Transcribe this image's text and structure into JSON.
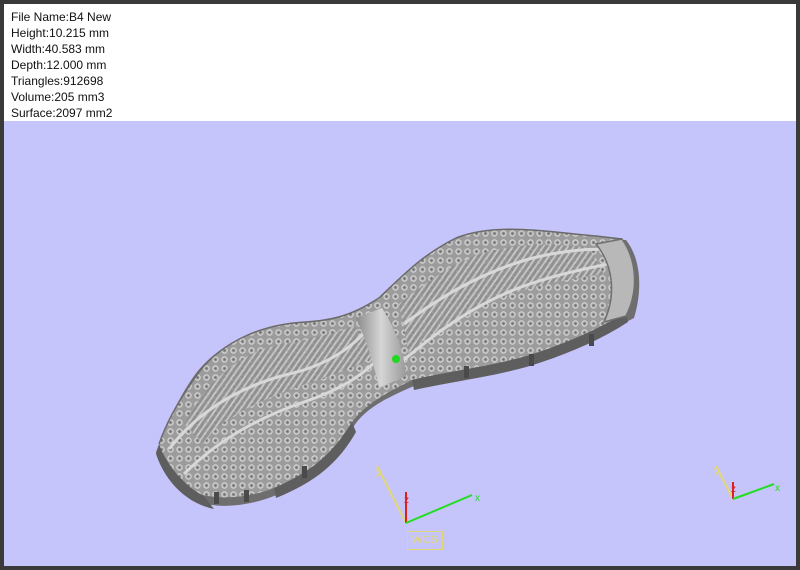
{
  "model_info": {
    "file_name": "File Name:B4 New",
    "height": "Height:10.215 mm",
    "width": "Width:40.583 mm",
    "depth": "Depth:12.000 mm",
    "triangles": "Triangles:912698",
    "volume": "Volume:205 mm3",
    "surface": "Surface:2097 mm2"
  },
  "viewport": {
    "background_color": "#c6c5fb",
    "model_color": "#a8a8a8",
    "pivot_marker_color": "#1fd81f"
  },
  "axes": {
    "x_label": "x",
    "y_label": "y",
    "z_label": "z",
    "x_color": "#22dd22",
    "y_color": "#e2d872",
    "z_color": "#e02020",
    "wcs_label": "WCS"
  }
}
